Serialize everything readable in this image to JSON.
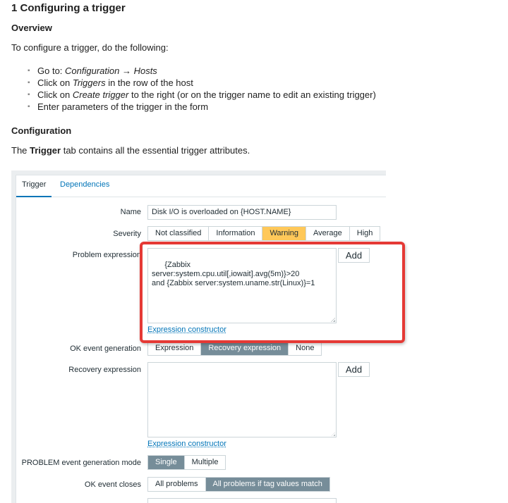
{
  "doc": {
    "title": "1 Configuring a trigger",
    "overview_heading": "Overview",
    "intro": "To configure a trigger, do the following:",
    "steps": [
      {
        "pre": "Go to: ",
        "em": "Configuration → Hosts",
        "post": ""
      },
      {
        "pre": "Click on ",
        "em": "Triggers",
        "post": " in the row of the host"
      },
      {
        "pre": "Click on ",
        "em": "Create trigger",
        "post": " to the right (or on the trigger name to edit an existing trigger)"
      },
      {
        "pre": "Enter parameters of the trigger in the form",
        "em": "",
        "post": ""
      }
    ],
    "config_heading": "Configuration",
    "config_text_pre": "The ",
    "config_text_bold": "Trigger",
    "config_text_post": " tab contains all the essential trigger attributes."
  },
  "form": {
    "tabs": [
      "Trigger",
      "Dependencies"
    ],
    "name_label": "Name",
    "name_value": "Disk I/O is overloaded on {HOST.NAME}",
    "severity_label": "Severity",
    "severity_options": [
      "Not classified",
      "Information",
      "Warning",
      "Average",
      "High"
    ],
    "severity_selected": "Warning",
    "problem_expr_label": "Problem expression",
    "problem_expr_value": "{Zabbix server:system.cpu.util[,iowait].avg(5m)}>20\nand {Zabbix server:system.uname.str(Linux)}=1",
    "add_label": "Add",
    "expr_constructor_label": "Expression constructor",
    "ok_event_label": "OK event generation",
    "ok_event_options": [
      "Expression",
      "Recovery expression",
      "None"
    ],
    "ok_event_selected": "Recovery expression",
    "recovery_expr_label": "Recovery expression",
    "recovery_expr_value": "",
    "problem_mode_label": "PROBLEM event generation mode",
    "problem_mode_options": [
      "Single",
      "Multiple"
    ],
    "problem_mode_selected": "Single",
    "ok_closes_label": "OK event closes",
    "ok_closes_options": [
      "All problems",
      "All problems if tag values match"
    ],
    "ok_closes_selected": "All problems if tag values match"
  },
  "colors": {
    "highlight": "#e53935",
    "link": "#0275b8",
    "severity_warning": "#ffc859",
    "selected_segment": "#768d99"
  }
}
